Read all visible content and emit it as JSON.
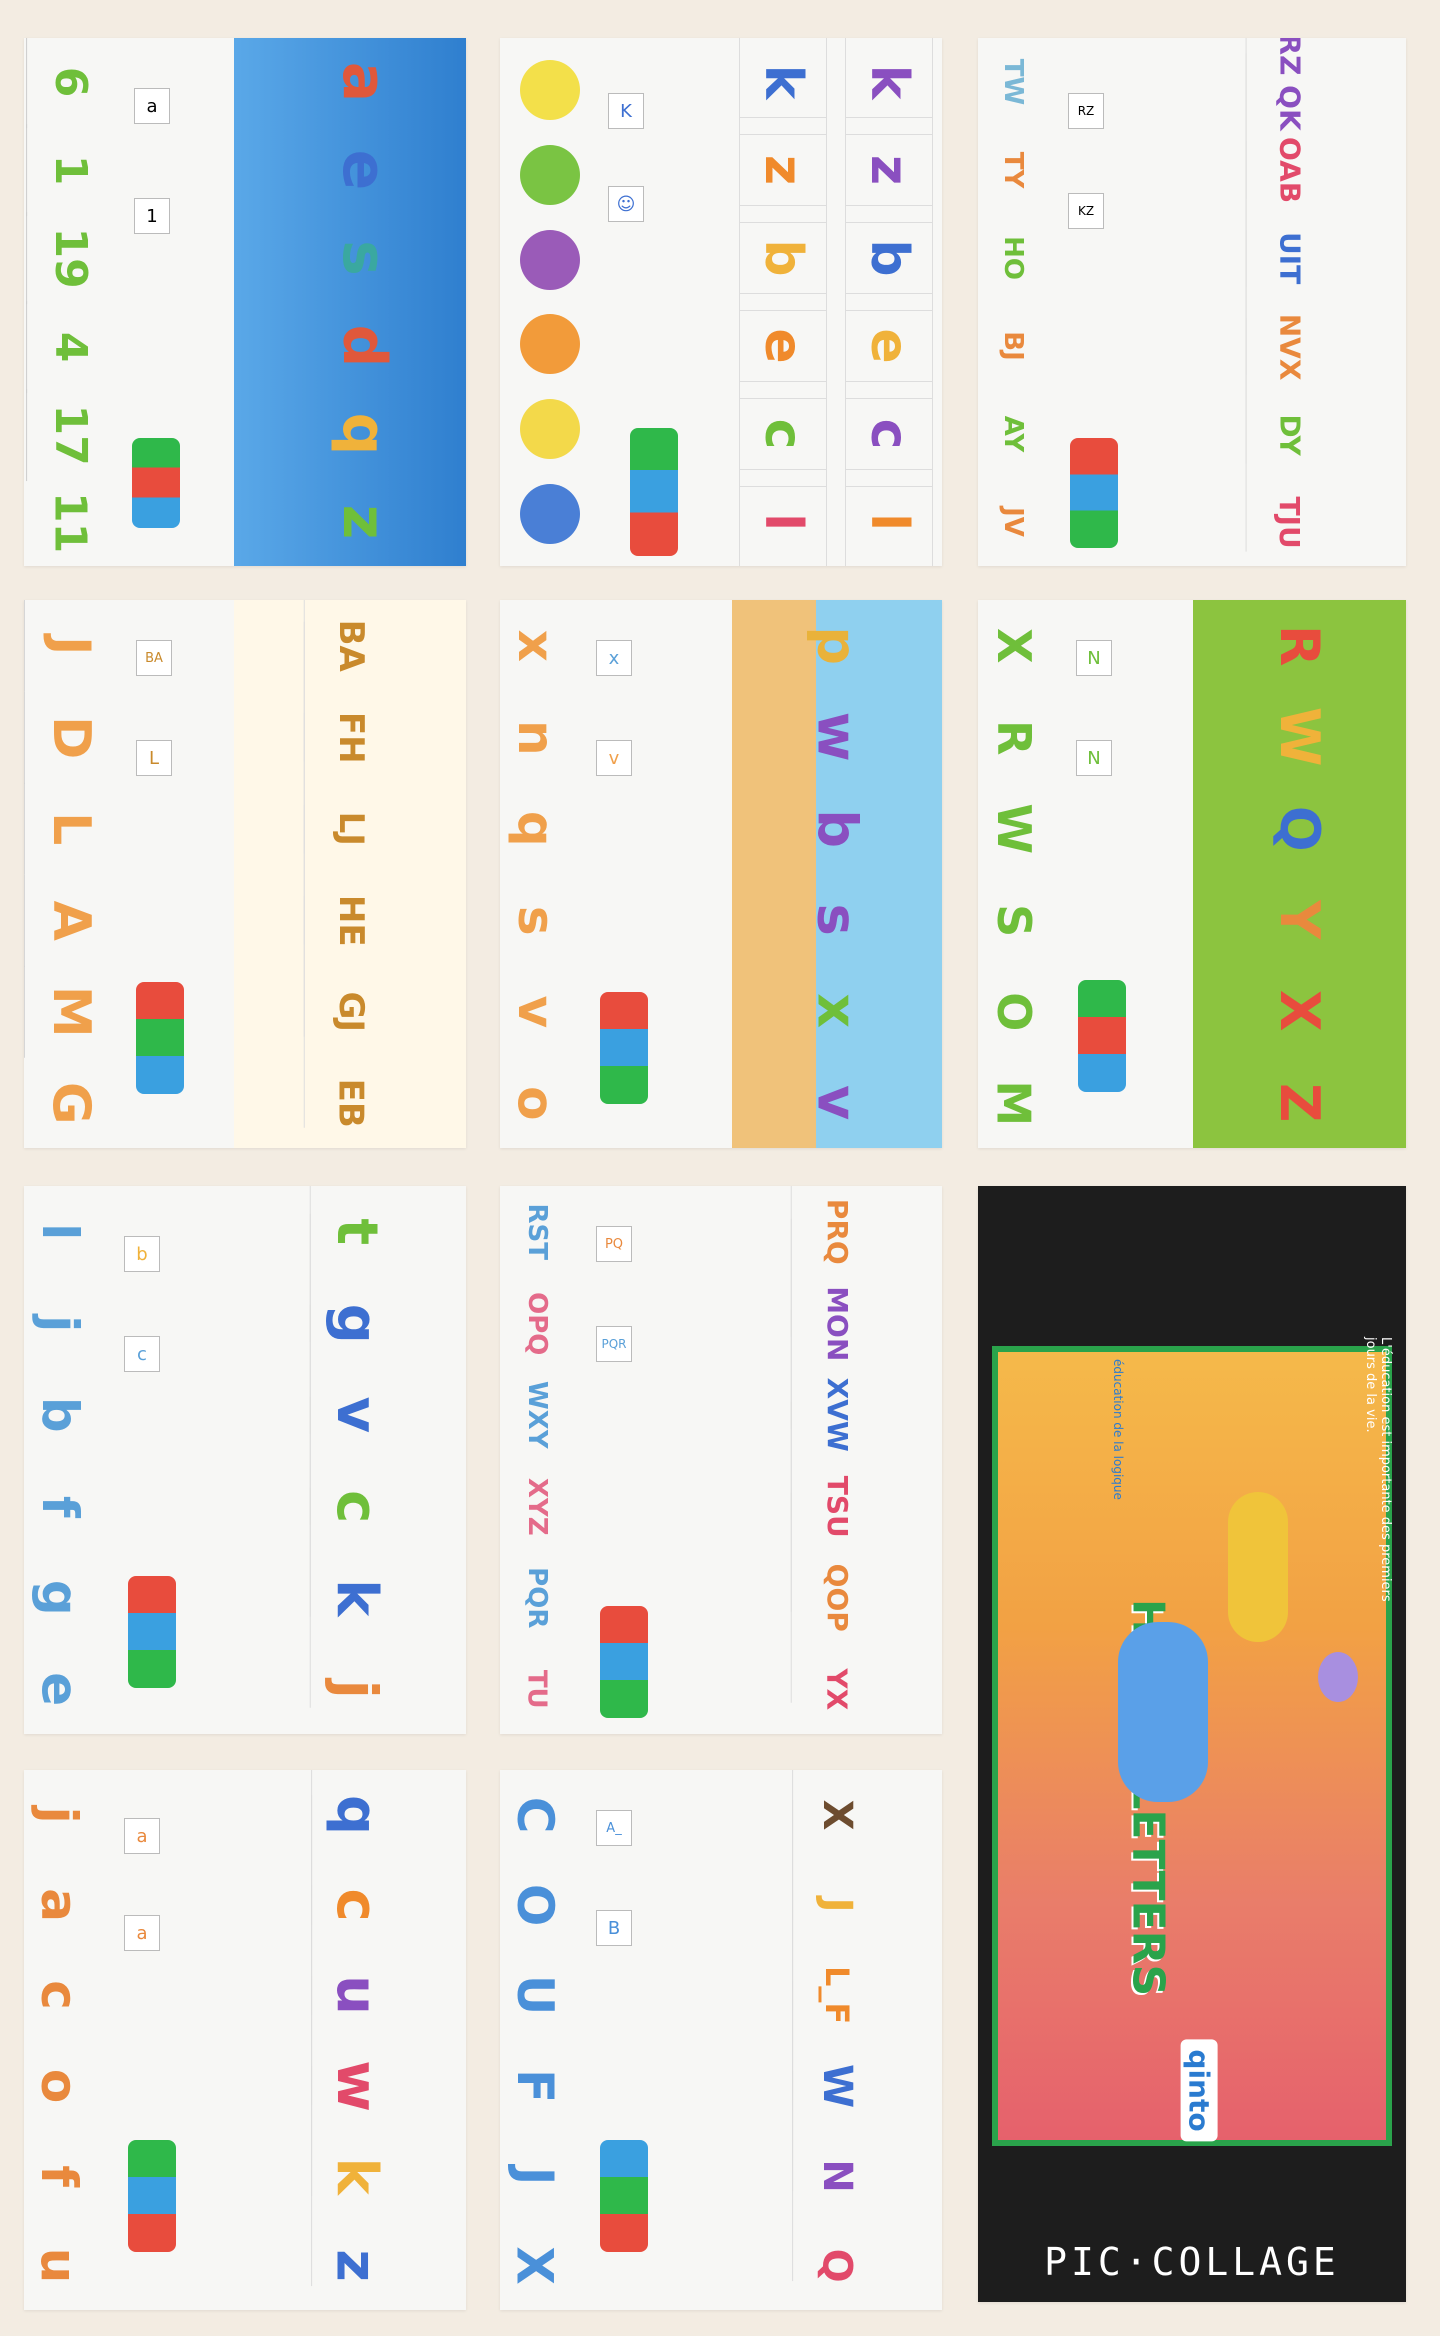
{
  "collage": {
    "footer_text": "PIC·COLLAGE",
    "background": "#f3ece2"
  },
  "tiles": [
    {
      "id": "tile-1-1",
      "letters": [
        "6",
        "1",
        "19",
        "4",
        "17",
        "11"
      ],
      "letters_color": "#6fbf3a",
      "key_from": "a",
      "key_to": "1",
      "pictures": [
        "a",
        "e",
        "s",
        "d",
        "q",
        "z"
      ],
      "picture_bg": "#4a90d9"
    },
    {
      "id": "tile-1-2",
      "letters": [
        "k",
        "z",
        "b",
        "e",
        "c",
        "l"
      ],
      "letters_color": "#e9893d",
      "key_from": "K",
      "key_to": "☺",
      "pictures": [
        "k",
        "z",
        "b",
        "e",
        "c",
        "l"
      ],
      "picture_bg": "#ffffff"
    },
    {
      "id": "tile-1-3",
      "letters": [
        "TW",
        "TY",
        "HO",
        "BJ",
        "AY",
        "JV"
      ],
      "letters_color": "#7bb8d6",
      "key_from": "RZ",
      "key_to": "KZ",
      "pictures": [
        "RZ QK",
        "OAB",
        "UIT",
        "NVX",
        "DY",
        "TJU"
      ],
      "picture_bg": "#ffffff"
    },
    {
      "id": "tile-2-1",
      "letters": [
        "J",
        "D",
        "L",
        "A",
        "M",
        "G"
      ],
      "letters_color": "#f0a04b",
      "key_from": "BA",
      "key_to": "L",
      "pictures": [
        "BA",
        "FH",
        "LJ",
        "HE",
        "GJ",
        "EB"
      ],
      "picture_bg": "#ffffff"
    },
    {
      "id": "tile-2-2",
      "letters": [
        "x",
        "n",
        "q",
        "s",
        "v",
        "o"
      ],
      "letters_color": "#f0a04b",
      "key_from": "x",
      "key_to": "v",
      "pictures": [
        "p",
        "w",
        "b",
        "s",
        "x",
        "v"
      ],
      "picture_bg": "#7cc6e8"
    },
    {
      "id": "tile-2-3",
      "letters": [
        "X",
        "R",
        "W",
        "S",
        "O",
        "M"
      ],
      "letters_color": "#6fbf3a",
      "key_from": "N",
      "key_to": "N",
      "pictures": [
        "R",
        "W",
        "Q",
        "Y",
        "X",
        "Z"
      ],
      "picture_bg": "#8cc43f"
    },
    {
      "id": "tile-3-1",
      "letters": [
        "l",
        "j",
        "b",
        "f",
        "g",
        "e"
      ],
      "letters_color": "#5aa0d8",
      "key_from": "b",
      "key_to": "c",
      "pictures": [
        "t",
        "g",
        "v",
        "c",
        "k",
        "j"
      ],
      "picture_bg": "#ffffff"
    },
    {
      "id": "tile-3-2",
      "letters": [
        "RST",
        "OPQ",
        "WXY",
        "XYZ",
        "PQR",
        "TU"
      ],
      "letters_color": "#e46b8a",
      "key_from": "PQ",
      "key_to": "PQR",
      "pictures": [
        "PRQ",
        "MON",
        "XVW",
        "TSU",
        "QOP",
        "YX"
      ],
      "picture_bg": "#ffffff"
    },
    {
      "id": "tile-3-3",
      "letters": [],
      "letters_color": "#2aa34b",
      "key_from": "",
      "key_to": "",
      "pictures": [],
      "picture_bg": "#e6616c",
      "box": {
        "brand": "qinto",
        "title": "HAPPY LETTERS",
        "tagline": "L'éducation est importante des premiers jours de la vie.",
        "subtitle": "éducation de la logique"
      }
    },
    {
      "id": "tile-4-1",
      "letters": [
        "j",
        "a",
        "c",
        "o",
        "f",
        "u"
      ],
      "letters_color": "#e9893d",
      "key_from": "a",
      "key_to": "a",
      "pictures": [
        "q",
        "c",
        "u",
        "w",
        "k",
        "z"
      ],
      "picture_bg": "#ffffff"
    },
    {
      "id": "tile-4-2",
      "letters": [
        "C",
        "O",
        "U",
        "F",
        "J",
        "X"
      ],
      "letters_color": "#4a90d9",
      "key_from": "A_",
      "key_to": "B",
      "pictures": [
        "X",
        "J",
        "L_F",
        "W",
        "N",
        "Q"
      ],
      "picture_bg": "#ffffff"
    }
  ]
}
